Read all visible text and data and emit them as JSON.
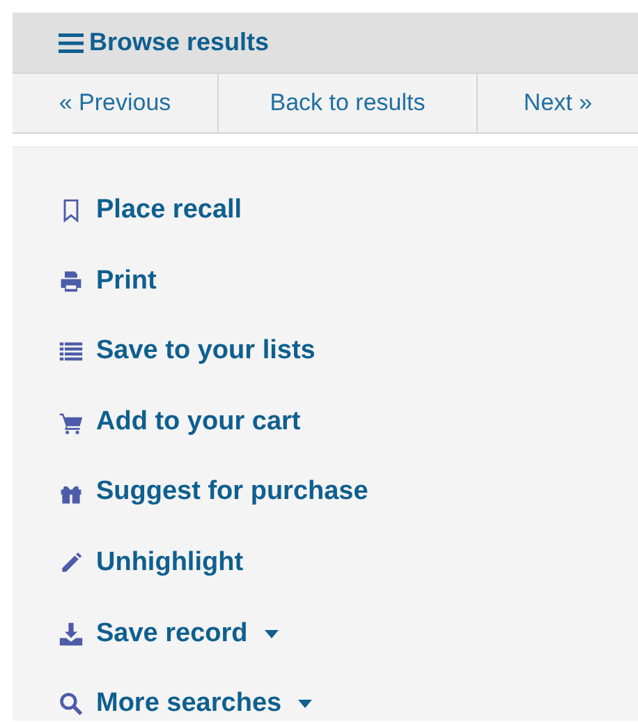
{
  "browse": {
    "title": "Browse results"
  },
  "pager": [
    {
      "label": "« Previous"
    },
    {
      "label": "Back to results"
    },
    {
      "label": "Next »"
    }
  ],
  "actions": [
    {
      "label": "Place recall",
      "dropdown": false
    },
    {
      "label": "Print",
      "dropdown": false
    },
    {
      "label": "Save to your lists",
      "dropdown": false
    },
    {
      "label": "Add to your cart",
      "dropdown": false
    },
    {
      "label": "Suggest for purchase",
      "dropdown": false
    },
    {
      "label": "Unhighlight",
      "dropdown": false
    },
    {
      "label": "Save record",
      "dropdown": true
    },
    {
      "label": "More searches",
      "dropdown": true
    }
  ]
}
